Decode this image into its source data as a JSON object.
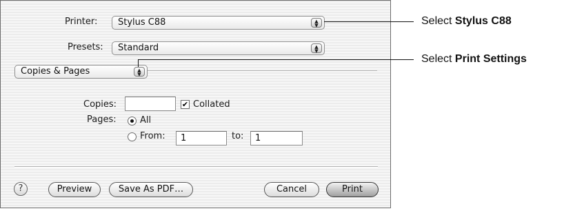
{
  "dialog": {
    "printer_label": "Printer:",
    "printer_value": "Stylus C88",
    "presets_label": "Presets:",
    "presets_value": "Standard",
    "panel_value": "Copies & Pages",
    "copies_label": "Copies:",
    "copies_value": "",
    "collated_label": "Collated",
    "collated_checked": true,
    "pages_label": "Pages:",
    "all_label": "All",
    "from_label": "From:",
    "from_value": "1",
    "to_label": "to:",
    "to_value": "1",
    "help_icon": "?",
    "preview_button": "Preview",
    "save_pdf_button": "Save As PDF…",
    "cancel_button": "Cancel",
    "print_button": "Print",
    "popup_arrow_icon": "up-down-arrows-icon",
    "check_mark": "✔"
  },
  "annotations": {
    "printer_prefix": "Select",
    "printer_bold": "Stylus C88",
    "panel_prefix": "Select",
    "panel_bold": "Print Settings"
  }
}
